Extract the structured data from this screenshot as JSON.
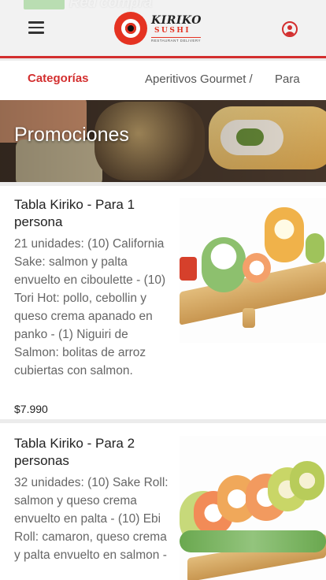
{
  "header": {
    "promo_text": "Red compra",
    "logo_brand": "KIRIKO",
    "logo_subbrand": "SUSHI",
    "logo_tagline": "RESTAURANT DELIVERY"
  },
  "category_nav": {
    "title": "Categorías",
    "items": [
      "Aperitivos Gourmet /",
      "Para"
    ]
  },
  "banner": {
    "title": "Promociones"
  },
  "products": [
    {
      "name": "Tabla Kiriko - Para 1 persona",
      "description": "21 unidades: (10) California Sake: salmon y palta envuelto en ciboulette - (10) Tori Hot: pollo, cebollin y queso crema apanado en panko - (1) Niguiri de Salmon: bolitas de arroz cubiertas con salmon.",
      "price": "$7.990"
    },
    {
      "name": "Tabla Kiriko - Para 2 personas",
      "description": "32 unidades: (10) Sake Roll: salmon y queso crema envuelto en palta - (10) Ebi Roll: camaron, queso crema y palta envuelto en salmon -",
      "price": ""
    }
  ],
  "colors": {
    "accent": "#d32f2f",
    "background": "#ececec"
  }
}
